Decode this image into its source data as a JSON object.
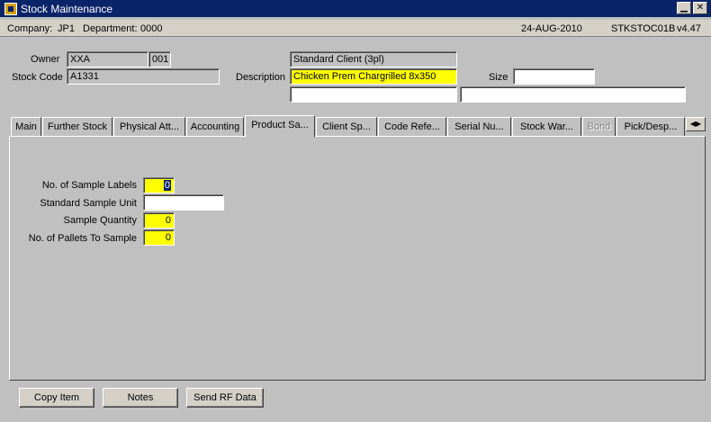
{
  "window": {
    "title": "Stock Maintenance"
  },
  "infobar": {
    "company_label": "Company:",
    "company": "JP1",
    "department_label": "Department:",
    "department": "0000",
    "date": "24-AUG-2010",
    "module": "STKSTOC01B",
    "version": "v4.47"
  },
  "header": {
    "owner_label": "Owner",
    "owner_code": "XXA",
    "owner_number": "001",
    "owner_name": "Standard Client (3pl)",
    "stock_code_label": "Stock Code",
    "stock_code": "A1331",
    "description_label": "Description",
    "description": "Chicken Prem Chargrilled 8x350",
    "description_2": "",
    "description_3": "",
    "size_label": "Size",
    "size": ""
  },
  "tabs": [
    {
      "label": "Main"
    },
    {
      "label": "Further Stock"
    },
    {
      "label": "Physical Att..."
    },
    {
      "label": "Accounting"
    },
    {
      "label": "Product Sa..."
    },
    {
      "label": "Client Sp..."
    },
    {
      "label": "Code Refe..."
    },
    {
      "label": "Serial Nu..."
    },
    {
      "label": "Stock War..."
    },
    {
      "label": "Bond"
    },
    {
      "label": "Pick/Desp..."
    }
  ],
  "product_sample": {
    "sample_labels_label": "No. of Sample Labels",
    "sample_labels": "0",
    "sample_unit_label": "Standard Sample Unit",
    "sample_unit": "",
    "sample_qty_label": "Sample Quantity",
    "sample_qty": "0",
    "pallets_label": "No. of Pallets To Sample",
    "pallets": "0"
  },
  "buttons": {
    "copy_item": "Copy Item",
    "notes": "Notes",
    "send_rf": "Send RF Data"
  },
  "icons": {
    "app": "app-icon",
    "minimize": "minimize-icon",
    "close": "close-icon",
    "tab_scroll": "tab-scroll-arrows-icon"
  },
  "colors": {
    "title_bar": "#0a246a",
    "required_field": "#ffff00",
    "window_bg": "#c0c0c0"
  }
}
